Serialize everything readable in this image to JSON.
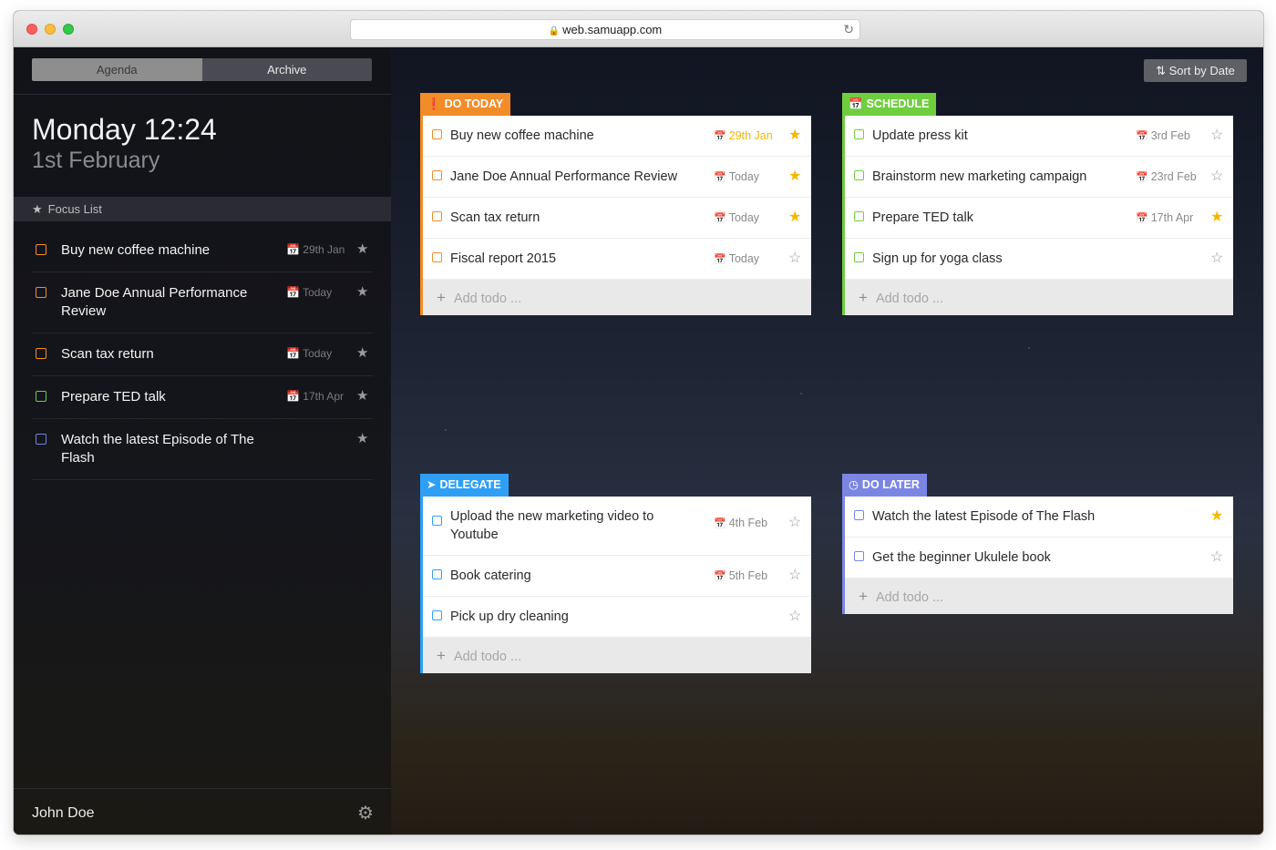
{
  "browser": {
    "url": "web.samuapp.com"
  },
  "sidebar": {
    "tabs": [
      {
        "label": "Agenda"
      },
      {
        "label": "Archive"
      }
    ],
    "clock": "Monday 12:24",
    "date": "1st February",
    "focus_list_label": "Focus List",
    "focus_items": [
      {
        "title": "Buy new coffee machine",
        "date": "29th Jan",
        "color": "#f28c28"
      },
      {
        "title": "Jane Doe Annual Performance Review",
        "date": "Today",
        "color": "#f28c28"
      },
      {
        "title": "Scan tax return",
        "date": "Today",
        "color": "#f28c28"
      },
      {
        "title": "Prepare TED talk",
        "date": "17th Apr",
        "color": "#6fce3e"
      },
      {
        "title": "Watch the latest Episode of The Flash",
        "date": "",
        "color": "#7b7fe3"
      }
    ],
    "user_name": "John Doe"
  },
  "main": {
    "sort_label": "Sort by Date",
    "quadrants": {
      "do_today": {
        "label": "DO TODAY",
        "color": "#f28c28",
        "items": [
          {
            "title": "Buy new coffee machine",
            "date": "29th Jan",
            "starred": true,
            "date_color": "#f5b700"
          },
          {
            "title": "Jane Doe Annual Performance Review",
            "date": "Today",
            "starred": true
          },
          {
            "title": "Scan tax return",
            "date": "Today",
            "starred": true
          },
          {
            "title": "Fiscal report 2015",
            "date": "Today",
            "starred": false
          }
        ],
        "add_placeholder": "Add todo ..."
      },
      "schedule": {
        "label": "SCHEDULE",
        "color": "#6fce3e",
        "items": [
          {
            "title": "Update press kit",
            "date": "3rd Feb",
            "starred": false
          },
          {
            "title": "Brainstorm new marketing campaign",
            "date": "23rd Feb",
            "starred": false
          },
          {
            "title": "Prepare TED talk",
            "date": "17th Apr",
            "starred": true
          },
          {
            "title": "Sign up for yoga class",
            "date": "",
            "starred": false
          }
        ],
        "add_placeholder": "Add todo ..."
      },
      "delegate": {
        "label": "DELEGATE",
        "color": "#2f9ff5",
        "items": [
          {
            "title": "Upload the new marketing video to Youtube",
            "date": "4th Feb",
            "starred": false
          },
          {
            "title": "Book catering",
            "date": "5th Feb",
            "starred": false
          },
          {
            "title": "Pick up dry cleaning",
            "date": "",
            "starred": false
          }
        ],
        "add_placeholder": "Add todo ..."
      },
      "do_later": {
        "label": "DO LATER",
        "color": "#7b86e3",
        "items": [
          {
            "title": "Watch the latest Episode of The Flash",
            "date": "",
            "starred": true
          },
          {
            "title": "Get the beginner Ukulele book",
            "date": "",
            "starred": false
          }
        ],
        "add_placeholder": "Add todo ..."
      }
    }
  }
}
